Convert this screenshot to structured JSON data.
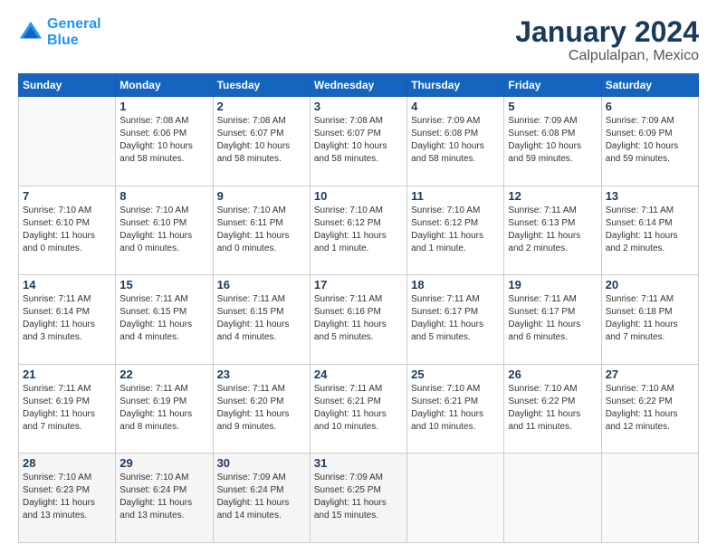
{
  "header": {
    "logo_line1": "General",
    "logo_line2": "Blue",
    "title": "January 2024",
    "subtitle": "Calpulalpan, Mexico"
  },
  "calendar": {
    "days_of_week": [
      "Sunday",
      "Monday",
      "Tuesday",
      "Wednesday",
      "Thursday",
      "Friday",
      "Saturday"
    ],
    "weeks": [
      [
        {
          "day": "",
          "info": ""
        },
        {
          "day": "1",
          "info": "Sunrise: 7:08 AM\nSunset: 6:06 PM\nDaylight: 10 hours\nand 58 minutes."
        },
        {
          "day": "2",
          "info": "Sunrise: 7:08 AM\nSunset: 6:07 PM\nDaylight: 10 hours\nand 58 minutes."
        },
        {
          "day": "3",
          "info": "Sunrise: 7:08 AM\nSunset: 6:07 PM\nDaylight: 10 hours\nand 58 minutes."
        },
        {
          "day": "4",
          "info": "Sunrise: 7:09 AM\nSunset: 6:08 PM\nDaylight: 10 hours\nand 58 minutes."
        },
        {
          "day": "5",
          "info": "Sunrise: 7:09 AM\nSunset: 6:08 PM\nDaylight: 10 hours\nand 59 minutes."
        },
        {
          "day": "6",
          "info": "Sunrise: 7:09 AM\nSunset: 6:09 PM\nDaylight: 10 hours\nand 59 minutes."
        }
      ],
      [
        {
          "day": "7",
          "info": "Sunrise: 7:10 AM\nSunset: 6:10 PM\nDaylight: 11 hours\nand 0 minutes."
        },
        {
          "day": "8",
          "info": "Sunrise: 7:10 AM\nSunset: 6:10 PM\nDaylight: 11 hours\nand 0 minutes."
        },
        {
          "day": "9",
          "info": "Sunrise: 7:10 AM\nSunset: 6:11 PM\nDaylight: 11 hours\nand 0 minutes."
        },
        {
          "day": "10",
          "info": "Sunrise: 7:10 AM\nSunset: 6:12 PM\nDaylight: 11 hours\nand 1 minute."
        },
        {
          "day": "11",
          "info": "Sunrise: 7:10 AM\nSunset: 6:12 PM\nDaylight: 11 hours\nand 1 minute."
        },
        {
          "day": "12",
          "info": "Sunrise: 7:11 AM\nSunset: 6:13 PM\nDaylight: 11 hours\nand 2 minutes."
        },
        {
          "day": "13",
          "info": "Sunrise: 7:11 AM\nSunset: 6:14 PM\nDaylight: 11 hours\nand 2 minutes."
        }
      ],
      [
        {
          "day": "14",
          "info": "Sunrise: 7:11 AM\nSunset: 6:14 PM\nDaylight: 11 hours\nand 3 minutes."
        },
        {
          "day": "15",
          "info": "Sunrise: 7:11 AM\nSunset: 6:15 PM\nDaylight: 11 hours\nand 4 minutes."
        },
        {
          "day": "16",
          "info": "Sunrise: 7:11 AM\nSunset: 6:15 PM\nDaylight: 11 hours\nand 4 minutes."
        },
        {
          "day": "17",
          "info": "Sunrise: 7:11 AM\nSunset: 6:16 PM\nDaylight: 11 hours\nand 5 minutes."
        },
        {
          "day": "18",
          "info": "Sunrise: 7:11 AM\nSunset: 6:17 PM\nDaylight: 11 hours\nand 5 minutes."
        },
        {
          "day": "19",
          "info": "Sunrise: 7:11 AM\nSunset: 6:17 PM\nDaylight: 11 hours\nand 6 minutes."
        },
        {
          "day": "20",
          "info": "Sunrise: 7:11 AM\nSunset: 6:18 PM\nDaylight: 11 hours\nand 7 minutes."
        }
      ],
      [
        {
          "day": "21",
          "info": "Sunrise: 7:11 AM\nSunset: 6:19 PM\nDaylight: 11 hours\nand 7 minutes."
        },
        {
          "day": "22",
          "info": "Sunrise: 7:11 AM\nSunset: 6:19 PM\nDaylight: 11 hours\nand 8 minutes."
        },
        {
          "day": "23",
          "info": "Sunrise: 7:11 AM\nSunset: 6:20 PM\nDaylight: 11 hours\nand 9 minutes."
        },
        {
          "day": "24",
          "info": "Sunrise: 7:11 AM\nSunset: 6:21 PM\nDaylight: 11 hours\nand 10 minutes."
        },
        {
          "day": "25",
          "info": "Sunrise: 7:10 AM\nSunset: 6:21 PM\nDaylight: 11 hours\nand 10 minutes."
        },
        {
          "day": "26",
          "info": "Sunrise: 7:10 AM\nSunset: 6:22 PM\nDaylight: 11 hours\nand 11 minutes."
        },
        {
          "day": "27",
          "info": "Sunrise: 7:10 AM\nSunset: 6:22 PM\nDaylight: 11 hours\nand 12 minutes."
        }
      ],
      [
        {
          "day": "28",
          "info": "Sunrise: 7:10 AM\nSunset: 6:23 PM\nDaylight: 11 hours\nand 13 minutes."
        },
        {
          "day": "29",
          "info": "Sunrise: 7:10 AM\nSunset: 6:24 PM\nDaylight: 11 hours\nand 13 minutes."
        },
        {
          "day": "30",
          "info": "Sunrise: 7:09 AM\nSunset: 6:24 PM\nDaylight: 11 hours\nand 14 minutes."
        },
        {
          "day": "31",
          "info": "Sunrise: 7:09 AM\nSunset: 6:25 PM\nDaylight: 11 hours\nand 15 minutes."
        },
        {
          "day": "",
          "info": ""
        },
        {
          "day": "",
          "info": ""
        },
        {
          "day": "",
          "info": ""
        }
      ]
    ]
  }
}
